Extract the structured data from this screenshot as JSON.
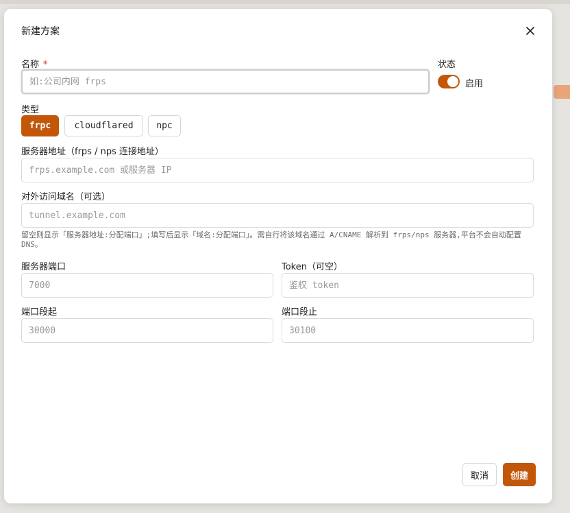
{
  "dialog": {
    "title": "新建方案",
    "close_icon": "close-icon"
  },
  "name_field": {
    "label": "名称",
    "required_mark": "*",
    "placeholder": "如:公司内网 frps",
    "value": ""
  },
  "status": {
    "label": "状态",
    "enabled": true,
    "toggle_label": "启用"
  },
  "type": {
    "label": "类型",
    "options": [
      "frpc",
      "cloudflared",
      "npc"
    ],
    "selected": "frpc"
  },
  "server_address": {
    "label": "服务器地址（frps / nps 连接地址）",
    "placeholder": "frps.example.com 或服务器 IP",
    "value": ""
  },
  "public_domain": {
    "label": "对外访问域名（可选）",
    "placeholder": "tunnel.example.com",
    "value": "",
    "hint": "留空则显示「服务器地址:分配端口」;填写后显示「域名:分配端口」。需自行将该域名通过 A/CNAME 解析到 frps/nps 服务器,平台不会自动配置 DNS。"
  },
  "server_port": {
    "label": "服务器端口",
    "placeholder": "7000",
    "value": ""
  },
  "token": {
    "label": "Token（可空）",
    "placeholder": "鉴权 token",
    "value": ""
  },
  "port_start": {
    "label": "端口段起",
    "placeholder": "30000",
    "value": ""
  },
  "port_end": {
    "label": "端口段止",
    "placeholder": "30100",
    "value": ""
  },
  "footer": {
    "cancel_label": "取消",
    "create_label": "创建"
  },
  "colors": {
    "accent": "#c2570a",
    "border": "#dcdad6",
    "placeholder": "#9a9a9a"
  }
}
